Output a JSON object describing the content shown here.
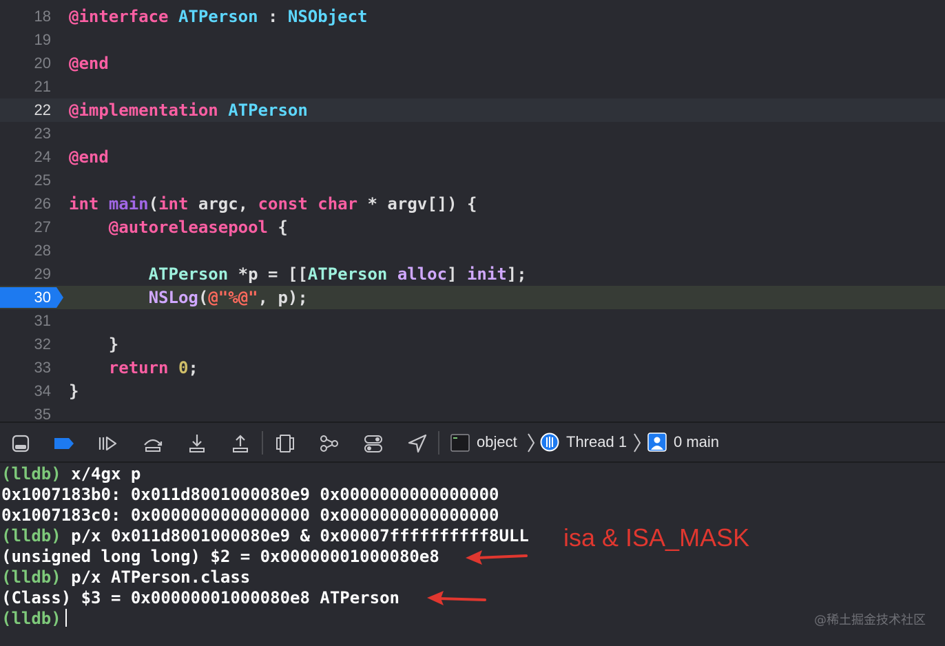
{
  "editor": {
    "lines": [
      {
        "n": "18",
        "tokens": [
          [
            "kw",
            "@interface"
          ],
          [
            "pl",
            " "
          ],
          [
            "ty",
            "ATPerson"
          ],
          [
            "pl",
            " : "
          ],
          [
            "ty",
            "NSObject"
          ]
        ]
      },
      {
        "n": "19",
        "tokens": []
      },
      {
        "n": "20",
        "tokens": [
          [
            "kw",
            "@end"
          ]
        ]
      },
      {
        "n": "21",
        "tokens": []
      },
      {
        "n": "22",
        "state": "current",
        "tokens": [
          [
            "kw",
            "@implementation"
          ],
          [
            "pl",
            " "
          ],
          [
            "ty",
            "ATPerson"
          ]
        ]
      },
      {
        "n": "23",
        "tokens": []
      },
      {
        "n": "24",
        "tokens": [
          [
            "kw",
            "@end"
          ]
        ]
      },
      {
        "n": "25",
        "tokens": []
      },
      {
        "n": "26",
        "tokens": [
          [
            "kw",
            "int"
          ],
          [
            "pl",
            " "
          ],
          [
            "fn",
            "main"
          ],
          [
            "pl",
            "("
          ],
          [
            "kw",
            "int"
          ],
          [
            "pl",
            " argc, "
          ],
          [
            "kw",
            "const"
          ],
          [
            "pl",
            " "
          ],
          [
            "kw",
            "char"
          ],
          [
            "pl",
            " * argv[]) {"
          ]
        ]
      },
      {
        "n": "27",
        "tokens": [
          [
            "pl",
            "    "
          ],
          [
            "kw",
            "@autoreleasepool"
          ],
          [
            "pl",
            " {"
          ]
        ]
      },
      {
        "n": "28",
        "tokens": []
      },
      {
        "n": "29",
        "tokens": [
          [
            "pl",
            "        "
          ],
          [
            "cls",
            "ATPerson"
          ],
          [
            "pl",
            " *p = [["
          ],
          [
            "cls",
            "ATPerson"
          ],
          [
            "pl",
            " "
          ],
          [
            "lib",
            "alloc"
          ],
          [
            "pl",
            "] "
          ],
          [
            "lib",
            "init"
          ],
          [
            "pl",
            "];"
          ]
        ]
      },
      {
        "n": "30",
        "state": "exec",
        "tokens": [
          [
            "pl",
            "        "
          ],
          [
            "lib",
            "NSLog"
          ],
          [
            "pl",
            "("
          ],
          [
            "str",
            "@\"%@\""
          ],
          [
            "pl",
            ", p);"
          ]
        ]
      },
      {
        "n": "31",
        "tokens": []
      },
      {
        "n": "32",
        "tokens": [
          [
            "pl",
            "    }"
          ]
        ]
      },
      {
        "n": "33",
        "tokens": [
          [
            "pl",
            "    "
          ],
          [
            "kw",
            "return"
          ],
          [
            "pl",
            " "
          ],
          [
            "num",
            "0"
          ],
          [
            "pl",
            ";"
          ]
        ]
      },
      {
        "n": "34",
        "tokens": [
          [
            "pl",
            "}"
          ]
        ]
      },
      {
        "n": "35",
        "tokens": []
      }
    ]
  },
  "debug_bar": {
    "buttons": [
      {
        "name": "hide-debug-area-button",
        "icon": "panel-icon"
      },
      {
        "name": "breakpoints-toggle-button",
        "icon": "breakpoint-icon"
      },
      {
        "name": "continue-button",
        "icon": "continue-icon"
      },
      {
        "name": "step-over-button",
        "icon": "step-over-icon"
      },
      {
        "name": "step-into-button",
        "icon": "step-into-icon"
      },
      {
        "name": "step-out-button",
        "icon": "step-out-icon"
      },
      {
        "name": "view-hierarchy-button",
        "icon": "view-hierarchy-icon"
      },
      {
        "name": "memory-graph-button",
        "icon": "memory-graph-icon"
      },
      {
        "name": "environment-overrides-button",
        "icon": "environment-overrides-icon"
      },
      {
        "name": "simulate-location-button",
        "icon": "location-icon"
      }
    ],
    "breadcrumb": {
      "process": "object",
      "thread": "Thread 1",
      "frame": "0 main"
    },
    "accent_color": "#1d7af0"
  },
  "console": {
    "lines": [
      {
        "prompt": "(lldb)",
        "text": " x/4gx p"
      },
      {
        "prompt": "",
        "text": "0x1007183b0: 0x011d8001000080e9 0x0000000000000000"
      },
      {
        "prompt": "",
        "text": "0x1007183c0: 0x0000000000000000 0x0000000000000000"
      },
      {
        "prompt": "(lldb)",
        "text": " p/x 0x011d8001000080e9 & 0x00007ffffffffff8ULL"
      },
      {
        "prompt": "",
        "text": "(unsigned long long) $2 = 0x00000001000080e8"
      },
      {
        "prompt": "(lldb)",
        "text": " p/x ATPerson.class"
      },
      {
        "prompt": "",
        "text": "(Class) $3 = 0x00000001000080e8 ATPerson"
      },
      {
        "prompt": "(lldb)",
        "text": "",
        "cursor": true
      }
    ],
    "annotation": "isa & ISA_MASK",
    "annotation_color": "#e0372f",
    "watermark": "@稀土掘金技术社区"
  }
}
